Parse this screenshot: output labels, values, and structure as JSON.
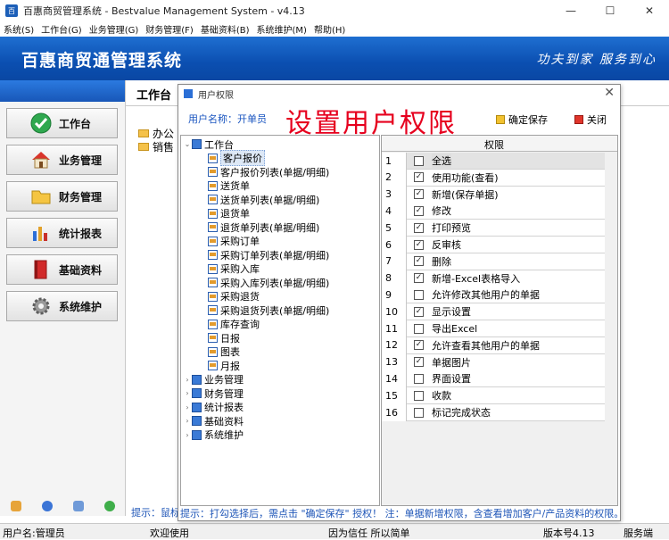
{
  "window": {
    "title": "百惠商贸管理系统 - Bestvalue Management System - v4.13",
    "buttons": [
      "—",
      "☐",
      "✕"
    ]
  },
  "menu": [
    "系统(S)",
    "工作台(G)",
    "业务管理(G)",
    "财务管理(F)",
    "基础资料(B)",
    "系统维护(M)",
    "帮助(H)"
  ],
  "banner": {
    "name": "百惠商贸通管理系统",
    "slogan": "功夫到家  服务到心"
  },
  "nav": [
    {
      "label": "工作台",
      "icon": "check-circle-icon"
    },
    {
      "label": "业务管理",
      "icon": "house-icon"
    },
    {
      "label": "财务管理",
      "icon": "folder-icon"
    },
    {
      "label": "统计报表",
      "icon": "bar-chart-icon"
    },
    {
      "label": "基础资料",
      "icon": "book-icon"
    },
    {
      "label": "系统维护",
      "icon": "gear-icon"
    }
  ],
  "main": {
    "tab": "工作台",
    "behind_tree": [
      "办公",
      "销售"
    ],
    "hint": "提示：鼠标"
  },
  "dialog": {
    "title": "用户权限",
    "user_label": "用户名称：开单员",
    "big_title": "设置用户权限",
    "save_label": "确定保存",
    "close_label": "关闭",
    "tree_root": "工作台",
    "tree_children": [
      "客户报价",
      "客户报价列表(单据/明细)",
      "送货单",
      "送货单列表(单据/明细)",
      "退货单",
      "退货单列表(单据/明细)",
      "采购订单",
      "采购订单列表(单据/明细)",
      "采购入库",
      "采购入库列表(单据/明细)",
      "采购退货",
      "采购退货列表(单据/明细)",
      "库存查询",
      "日报",
      "图表",
      "月报"
    ],
    "tree_groups": [
      "业务管理",
      "财务管理",
      "统计报表",
      "基础资料",
      "系统维护"
    ],
    "grid_header": "权限",
    "permissions": [
      {
        "n": "1",
        "label": "全选",
        "checked": false
      },
      {
        "n": "2",
        "label": "使用功能(查看)",
        "checked": true
      },
      {
        "n": "3",
        "label": "新增(保存单据)",
        "checked": true
      },
      {
        "n": "4",
        "label": "修改",
        "checked": true
      },
      {
        "n": "5",
        "label": "打印预览",
        "checked": true
      },
      {
        "n": "6",
        "label": "反审核",
        "checked": true
      },
      {
        "n": "7",
        "label": "删除",
        "checked": true
      },
      {
        "n": "8",
        "label": "新增-Excel表格导入",
        "checked": true
      },
      {
        "n": "9",
        "label": "允许修改其他用户的单据",
        "checked": false
      },
      {
        "n": "10",
        "label": "显示设置",
        "checked": true
      },
      {
        "n": "11",
        "label": "导出Excel",
        "checked": false
      },
      {
        "n": "12",
        "label": "允许查看其他用户的单据",
        "checked": true
      },
      {
        "n": "13",
        "label": "单据图片",
        "checked": true
      },
      {
        "n": "14",
        "label": "界面设置",
        "checked": false
      },
      {
        "n": "15",
        "label": "收款",
        "checked": false
      },
      {
        "n": "16",
        "label": "标记完成状态",
        "checked": false
      }
    ],
    "hint": "提示：打勾选择后，需点击 \"确定保存\" 授权！ 注：单据新增权限，含查看增加客户/产品资料的权限。"
  },
  "status": {
    "user": "用户名:管理员",
    "welcome": "欢迎使用",
    "motto": "因为信任 所以简单",
    "version": "版本号4.13",
    "service": "服务端"
  },
  "colors": {
    "banner": "#0b4fb1",
    "accent_red": "#e6001e",
    "hint_blue": "#1e55b7"
  }
}
